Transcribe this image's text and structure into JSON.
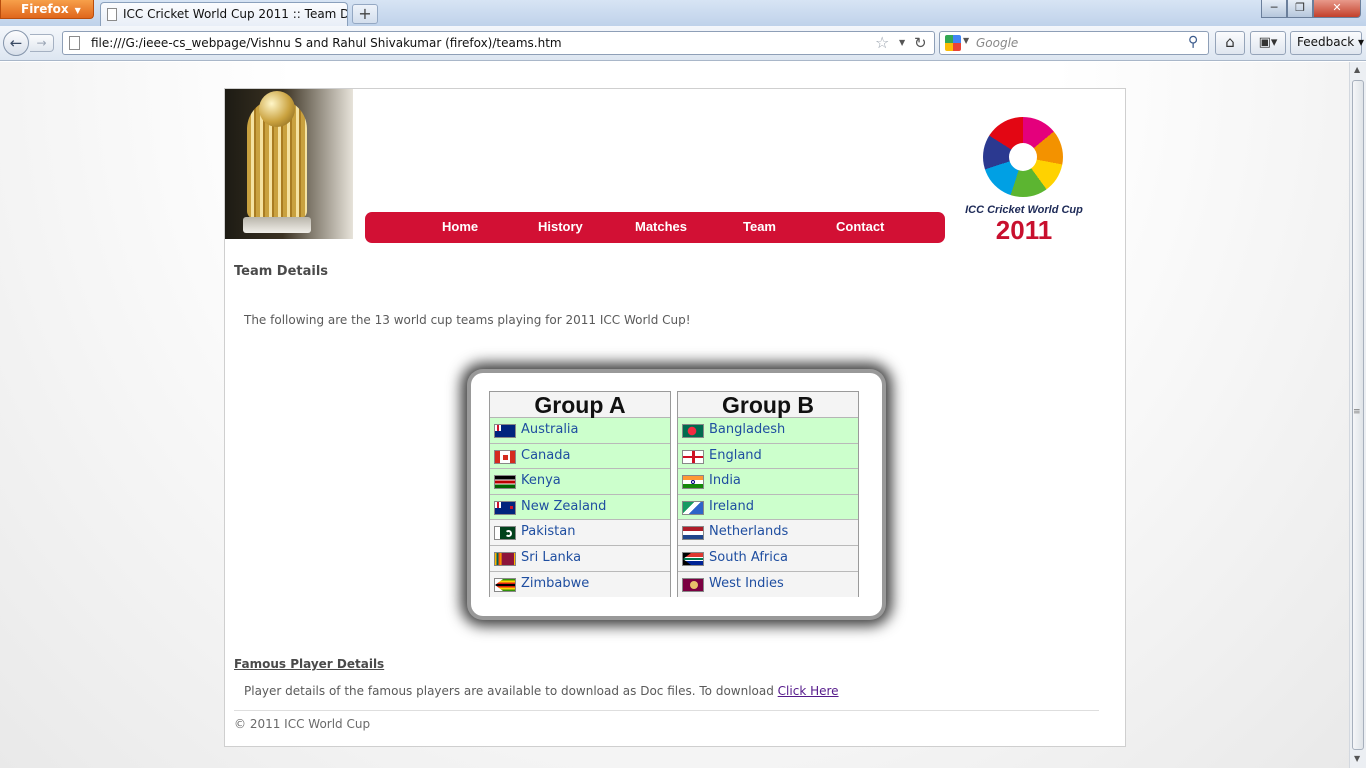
{
  "browser": {
    "app_button": "Firefox",
    "tab_title": "ICC Cricket World Cup 2011 :: Team Det...",
    "url": "file:///G:/ieee-cs_webpage/Vishnu S and Rahul Shivakumar (firefox)/teams.htm",
    "search_placeholder": "Google",
    "feedback_label": "Feedback"
  },
  "nav": {
    "items": [
      "Home",
      "History",
      "Matches",
      "Team",
      "Contact"
    ]
  },
  "logo": {
    "subtitle": "ICC Cricket World Cup",
    "year": "2011"
  },
  "content": {
    "heading": "Team Details",
    "intro": "The following are the 13 world cup teams playing for 2011 ICC World Cup!",
    "groups": [
      {
        "title": "Group A",
        "teams": [
          {
            "name": "Australia",
            "qualified": true
          },
          {
            "name": "Canada",
            "qualified": true
          },
          {
            "name": "Kenya",
            "qualified": true
          },
          {
            "name": "New Zealand",
            "qualified": true
          },
          {
            "name": "Pakistan",
            "qualified": false
          },
          {
            "name": "Sri Lanka",
            "qualified": false
          },
          {
            "name": "Zimbabwe",
            "qualified": false
          }
        ]
      },
      {
        "title": "Group B",
        "teams": [
          {
            "name": "Bangladesh",
            "qualified": true
          },
          {
            "name": "England",
            "qualified": true
          },
          {
            "name": "India",
            "qualified": true
          },
          {
            "name": "Ireland",
            "qualified": true
          },
          {
            "name": "Netherlands",
            "qualified": false
          },
          {
            "name": "South Africa",
            "qualified": false
          },
          {
            "name": "West Indies",
            "qualified": false
          }
        ]
      }
    ],
    "famous_title": "Famous Player Details",
    "famous_text": "Player details of the famous players are available to download as Doc files. To download ",
    "famous_link": "Click Here",
    "footer": "© 2011 ICC World Cup"
  },
  "colors": {
    "menu_red": "#d21034",
    "row_highlight": "#ccffcc",
    "team_link": "#1f4ea0"
  }
}
